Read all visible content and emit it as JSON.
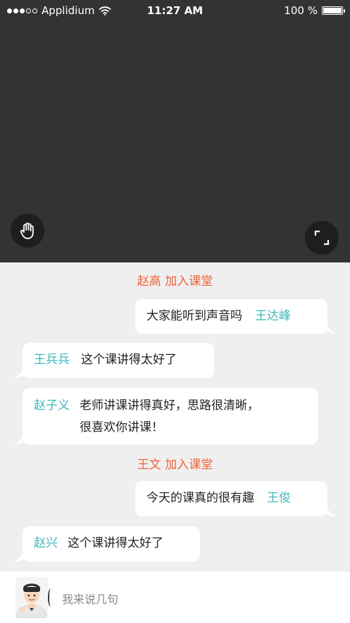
{
  "status_bar": {
    "carrier": "Applidium",
    "time": "11:27 AM",
    "battery": "100 %",
    "battery_level": 1.0
  },
  "video": {
    "raise_hand_icon": "hand-icon",
    "fullscreen_icon": "fullscreen-icon"
  },
  "chat": {
    "join1": "赵高 加入课堂",
    "msg1": {
      "name": "王达峰",
      "text": "大家能听到声音吗"
    },
    "msg2": {
      "name": "王兵兵",
      "text": "这个课讲得太好了"
    },
    "msg3": {
      "name": "赵子义",
      "line1": "老师讲课讲得真好，思路很清晰，",
      "line2": "很喜欢你讲课！"
    },
    "join2": "王文 加入课堂",
    "msg4": {
      "name": "王俊",
      "text": "今天的课真的很有趣"
    },
    "msg5": {
      "name": "赵兴",
      "text": "这个课讲得太好了"
    }
  },
  "input": {
    "placeholder": "我来说几句"
  },
  "colors": {
    "video_bg": "#333333",
    "chat_bg": "#efefef",
    "join_text": "#f0623a",
    "name_text": "#3cb8bc"
  }
}
